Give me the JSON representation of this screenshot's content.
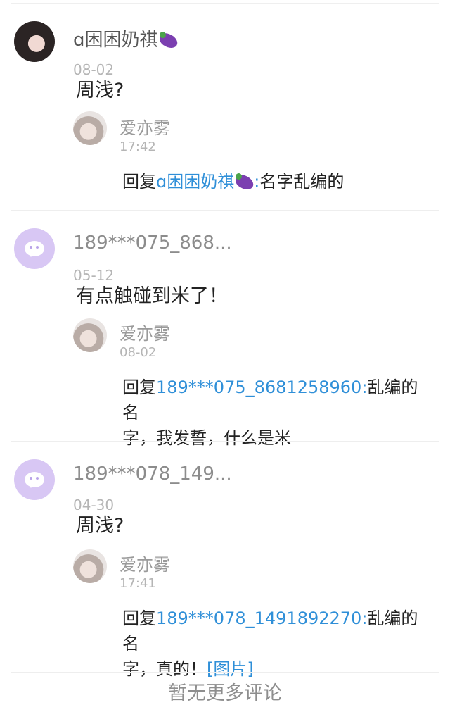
{
  "comments": [
    {
      "username": "ɑ困困奶祺",
      "username_emoji": "eggplant-icon",
      "date": "08-02",
      "content": "周浅?",
      "reply": {
        "username": "爱亦雾",
        "time": "17:42",
        "prefix": "回复",
        "mention": "ɑ困困奶祺",
        "mention_emoji": "eggplant-icon",
        "colon": ":",
        "text": "名字乱编的",
        "text_line2": ""
      }
    },
    {
      "username": "189***075_868...",
      "date": "05-12",
      "content": "有点触碰到米了！",
      "reply": {
        "username": "爱亦雾",
        "time": "08-02",
        "prefix": "回复",
        "mention": "189***075_8681258960",
        "colon": ":",
        "text": "乱编的名",
        "text_line2": "字，我发誓，什么是米"
      }
    },
    {
      "username": "189***078_149...",
      "date": "04-30",
      "content": "周浅?",
      "reply": {
        "username": "爱亦雾",
        "time": "17:41",
        "prefix": "回复",
        "mention": "189***078_1491892270",
        "colon": ":",
        "text": "乱编的名",
        "text_line2": "字，真的！",
        "image_link": "[图片]"
      }
    }
  ],
  "footer": "暂无更多评论",
  "colors": {
    "link": "#2f8fd8",
    "default_avatar": "#d8c7f4"
  }
}
